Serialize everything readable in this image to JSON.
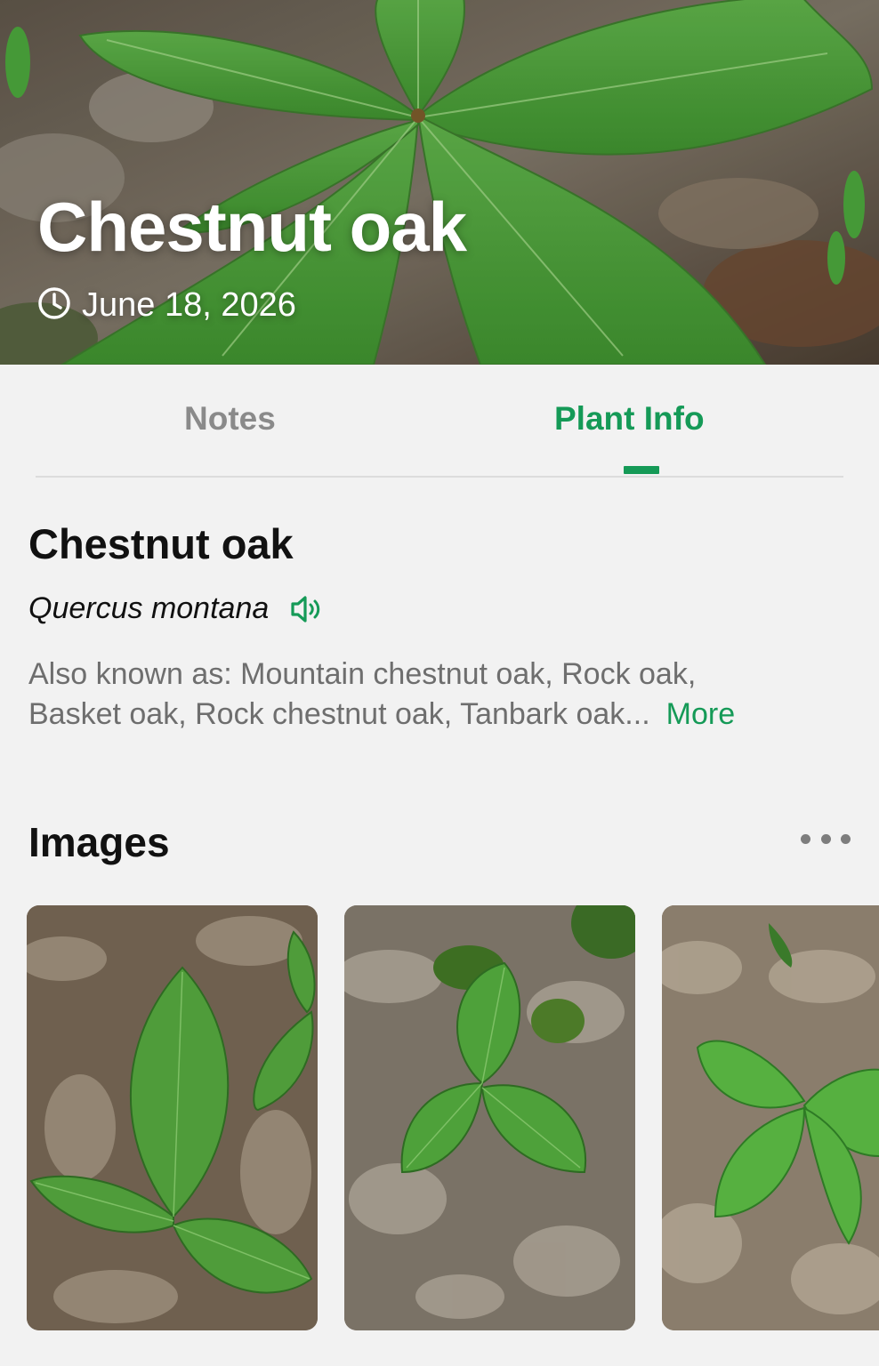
{
  "header": {
    "title": "Chestnut oak",
    "date": "June 18, 2026",
    "date_icon": "clock-icon"
  },
  "tabs": [
    {
      "label": "Notes",
      "active": false
    },
    {
      "label": "Plant Info",
      "active": true
    }
  ],
  "plant": {
    "common_name": "Chestnut oak",
    "scientific_name": "Quercus montana",
    "pronounce_icon": "speaker-icon",
    "aka_line1": "Also known as: Mountain chestnut oak, Rock oak,",
    "aka_line2": "Basket oak, Rock chestnut oak, Tanbark oak...",
    "more_label": "More"
  },
  "images": {
    "heading": "Images",
    "menu_icon": "more-dots-icon",
    "count_visible": 3
  },
  "colors": {
    "accent": "#159a57",
    "background": "#f2f2f2",
    "muted_text": "#6e6e6e",
    "inactive_tab": "#8a8a8a"
  }
}
